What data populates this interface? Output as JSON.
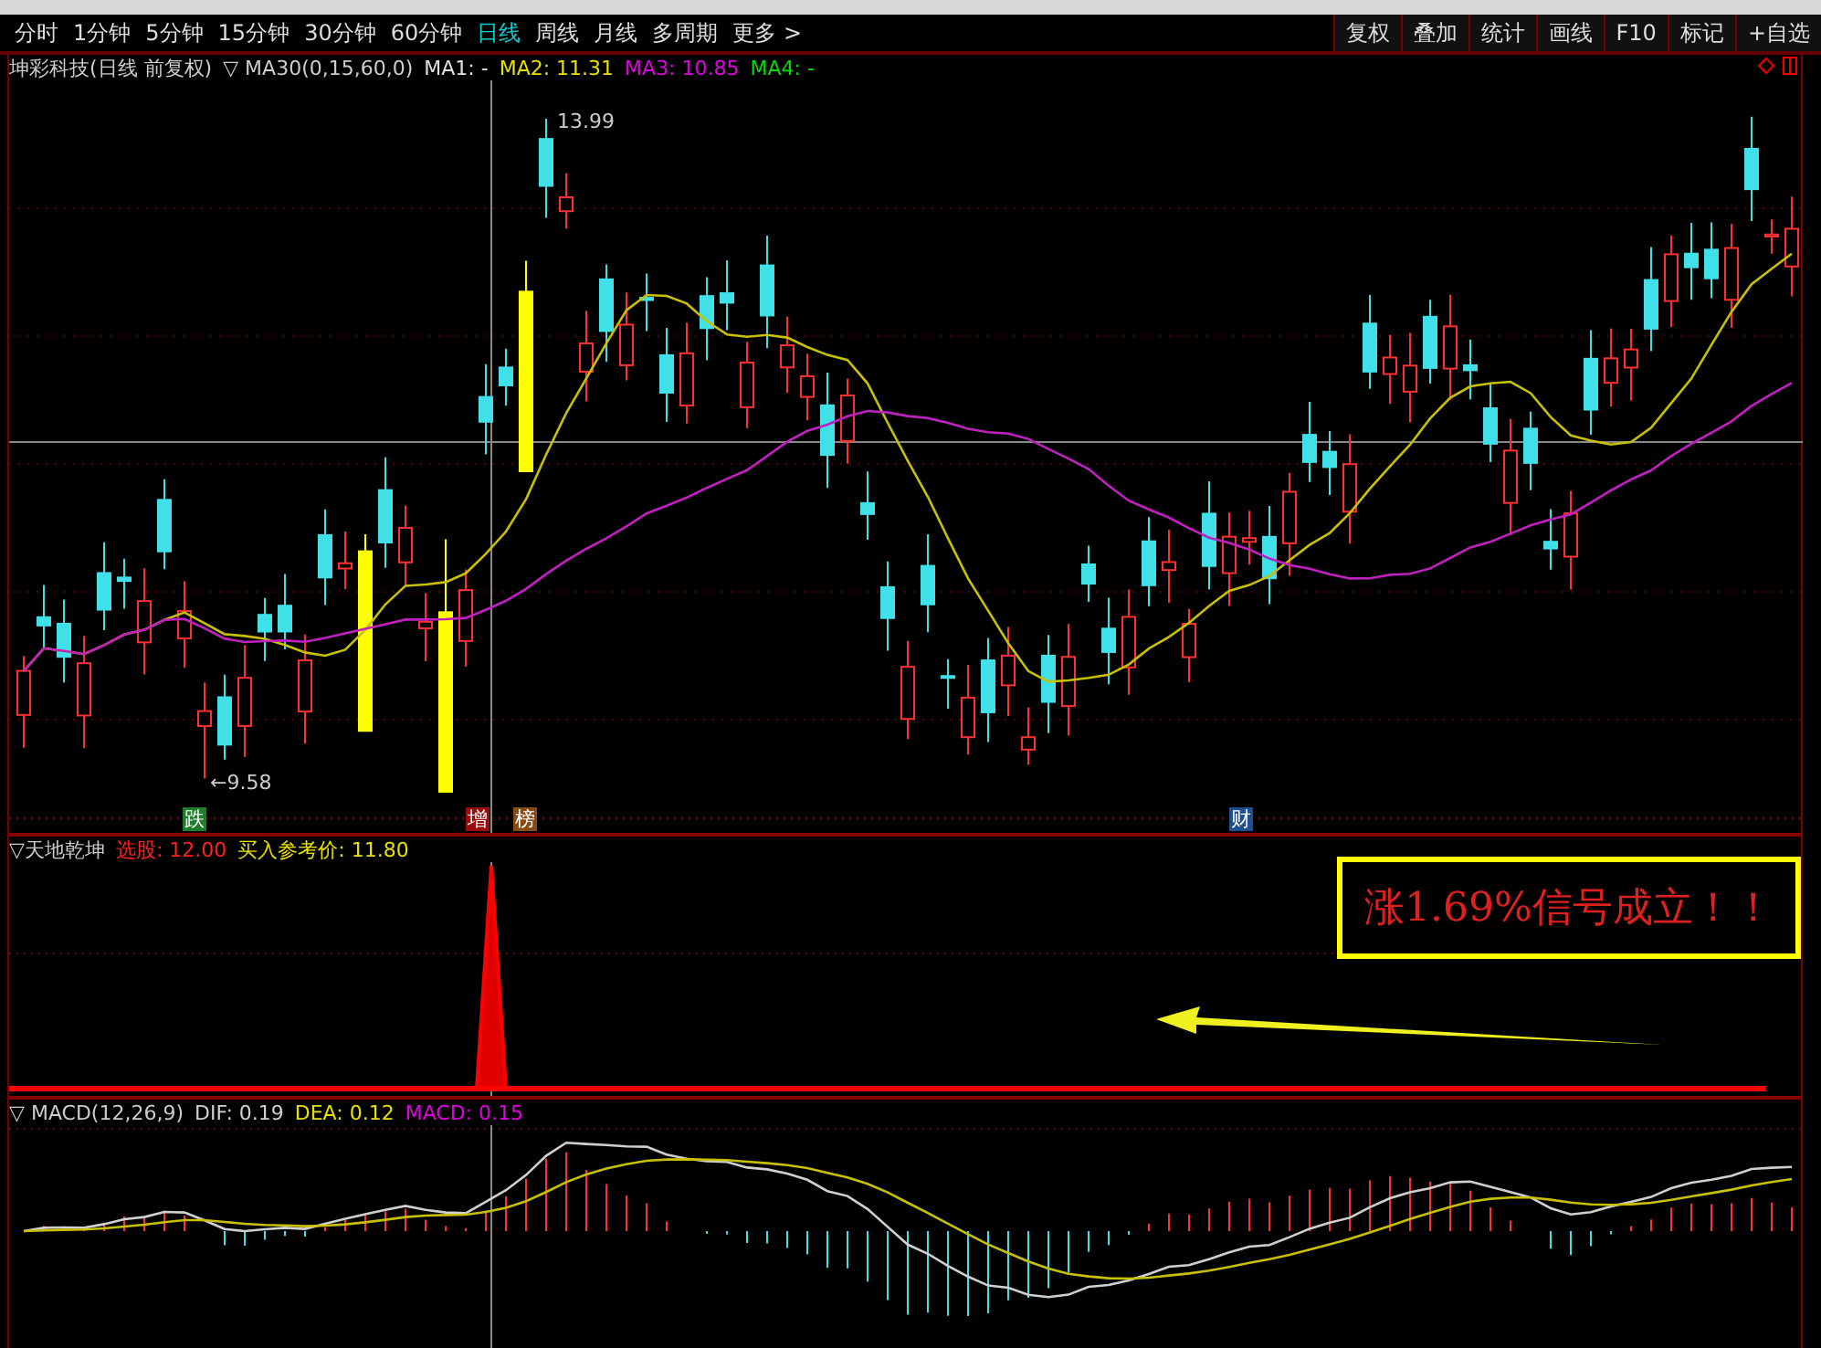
{
  "toolbar": {
    "periods": [
      {
        "label": "分时",
        "selected": false
      },
      {
        "label": "1分钟",
        "selected": false
      },
      {
        "label": "5分钟",
        "selected": false
      },
      {
        "label": "15分钟",
        "selected": false
      },
      {
        "label": "30分钟",
        "selected": false
      },
      {
        "label": "60分钟",
        "selected": false
      },
      {
        "label": "日线",
        "selected": true
      },
      {
        "label": "周线",
        "selected": false
      },
      {
        "label": "月线",
        "selected": false
      },
      {
        "label": "多周期",
        "selected": false
      }
    ],
    "more": "更多 >",
    "tools": [
      "复权",
      "叠加",
      "统计",
      "画线",
      "F10",
      "标记",
      "+自选"
    ]
  },
  "main_chart": {
    "title": "坤彩科技(日线 前复权)",
    "indicator": "▽ MA30(0,15,60,0)",
    "legend": [
      {
        "text": "MA1: -",
        "color": "#e0e0e0"
      },
      {
        "text": "MA2: 11.31",
        "color": "#e8e000"
      },
      {
        "text": "MA3: 10.85",
        "color": "#e000e0"
      },
      {
        "text": "MA4: -",
        "color": "#00e000"
      }
    ],
    "high_label": "13.99",
    "low_label": "←9.58",
    "markers": [
      {
        "text": "跌",
        "color": "#1d7d2a"
      },
      {
        "text": "增",
        "color": "#9a0b0b"
      },
      {
        "text": "榜",
        "color": "#8a4a14"
      },
      {
        "text": "财",
        "color": "#1f4f8f"
      }
    ]
  },
  "signal_panel": {
    "title": "▽天地乾坤",
    "legend": [
      {
        "text": "选股: 12.00",
        "color": "#ff2020"
      },
      {
        "text": "买入参考价: 11.80",
        "color": "#e8e000"
      }
    ],
    "callout": "涨1.69%信号成立！！"
  },
  "macd_panel": {
    "title": "▽ MACD(12,26,9)",
    "legend": [
      {
        "text": "DIF: 0.19",
        "color": "#d0d0d0"
      },
      {
        "text": "DEA: 0.12",
        "color": "#e8e000"
      },
      {
        "text": "MACD: 0.15",
        "color": "#e000e0"
      }
    ]
  }
}
